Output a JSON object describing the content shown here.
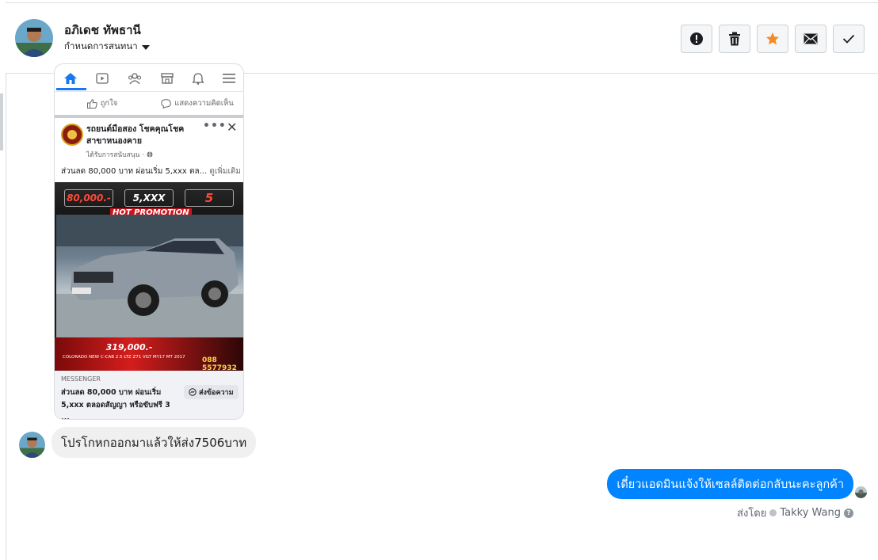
{
  "header": {
    "contact_name": "อภิเดช ทัพธานี",
    "assign_label": "กำหนดการสนทนา",
    "actions": [
      {
        "name": "report-button",
        "icon": "alert-circle-icon"
      },
      {
        "name": "delete-button",
        "icon": "trash-icon"
      },
      {
        "name": "star-button",
        "icon": "star-icon",
        "color": "#f38b28"
      },
      {
        "name": "mark-unread-button",
        "icon": "envelope-icon"
      },
      {
        "name": "mark-done-button",
        "icon": "check-icon"
      }
    ]
  },
  "ad_card": {
    "nav_icons": [
      "home-icon",
      "video-icon",
      "groups-icon",
      "marketplace-icon",
      "bell-icon",
      "menu-icon"
    ],
    "like_label": "ถูกใจ",
    "comment_label": "แสดงความคิดเห็น",
    "page_name": "รถยนต์มือสอง โชคคุณโชค สาขาหนองคาย",
    "sponsored": "ได้รับการสนับสนุน · ",
    "caption": "ส่วนลด 80,000 บาท ผ่อนเริ่ม 5,xxx ตล...",
    "see_more": "ดูเพิ่มเติม",
    "promo": {
      "discount": "80,000.-",
      "installment": "5,XXX",
      "term": "5",
      "hot": "HOT PROMOTION",
      "price": "319,000.-",
      "phone": "088 5577932",
      "model": "COLORADO NEW C-CAB 2.5 LTZ Z71 VGT MY17 MT 2017"
    },
    "cta": {
      "source_label": "MESSENGER",
      "title": "ส่วนลด 80,000 บาท ผ่อนเริ่ม 5,xxx ตลอดสัญญา หรือขับฟรี 3 ...",
      "button": "ส่งข้อความ"
    }
  },
  "messages": {
    "incoming": "โปรโกหกออกมาแล้วให้ส่ง7506บาท",
    "outgoing": "เดี๋ยวแอดมินแจ้งให้เซลล์ติดต่อกลับนะคะลูกค้า",
    "sent_by_label": "ส่งโดย",
    "sender_name": "Takky Wang"
  },
  "colors": {
    "accent": "#1877f2",
    "outgoing_bubble": "#0084ff",
    "incoming_bubble": "#f0f0f0",
    "star": "#f38b28"
  }
}
